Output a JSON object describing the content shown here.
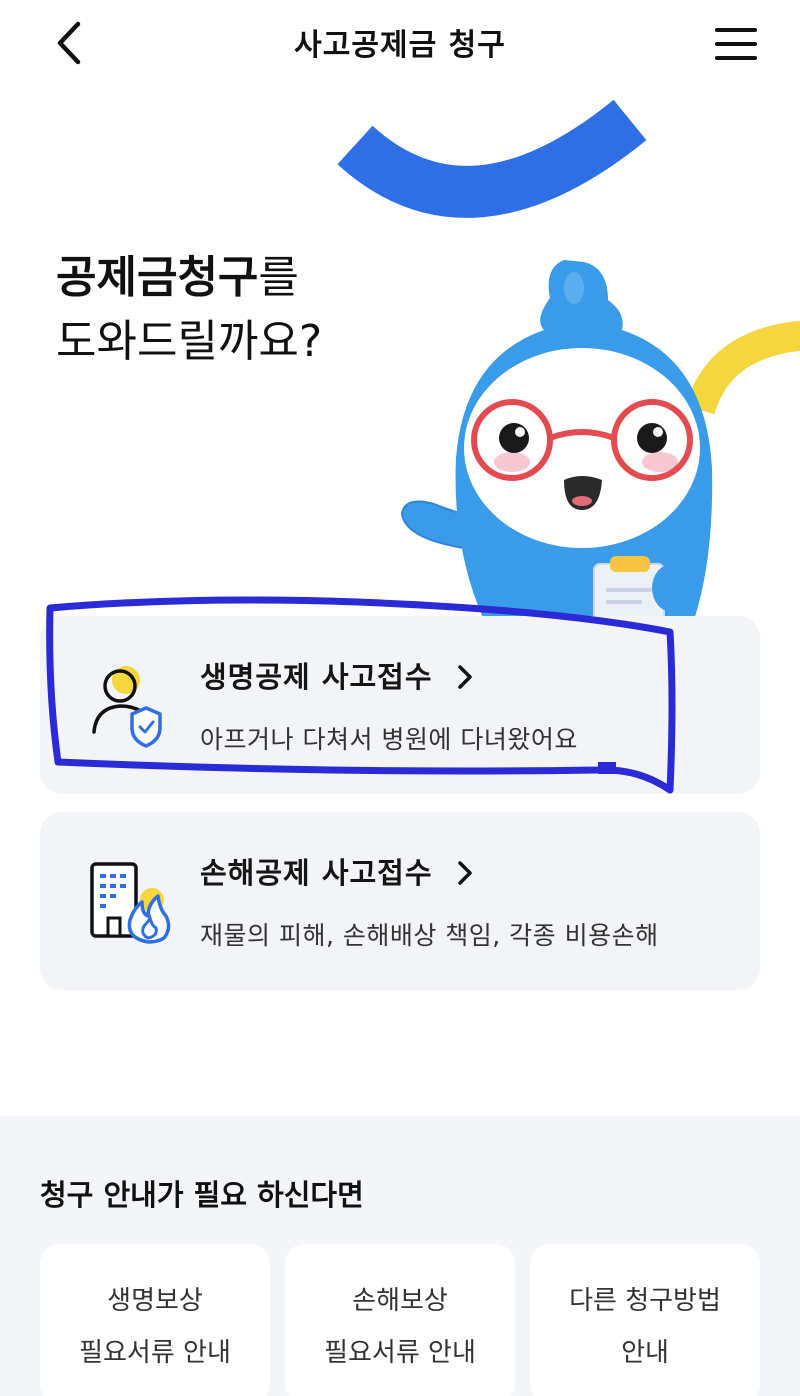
{
  "header": {
    "title": "사고공제금 청구",
    "back_icon": "chevron-left-icon",
    "menu_icon": "hamburger-menu-icon"
  },
  "hero": {
    "title_strong": "공제금청구",
    "title_suffix": "를",
    "title_line2": "도와드릴까요?"
  },
  "cards": [
    {
      "title": "생명공제 사고접수",
      "description": "아프거나 다쳐서 병원에 다녀왔어요",
      "icon": "person-shield-icon"
    },
    {
      "title": "손해공제 사고접수",
      "description": "재물의 피해, 손해배상 책임, 각종 비용손해",
      "icon": "building-fire-icon"
    }
  ],
  "guide": {
    "heading": "청구 안내가 필요 하신다면",
    "items": [
      {
        "line1": "생명보상",
        "line2": "필요서류 안내"
      },
      {
        "line1": "손해보상",
        "line2": "필요서류 안내"
      },
      {
        "line1": "다른 청구방법",
        "line2": "안내"
      }
    ]
  },
  "colors": {
    "accent_blue": "#2f6fe6",
    "accent_yellow": "#f5d63d",
    "card_bg": "#f3f4f8",
    "highlight_stroke": "#2a2ad6"
  }
}
